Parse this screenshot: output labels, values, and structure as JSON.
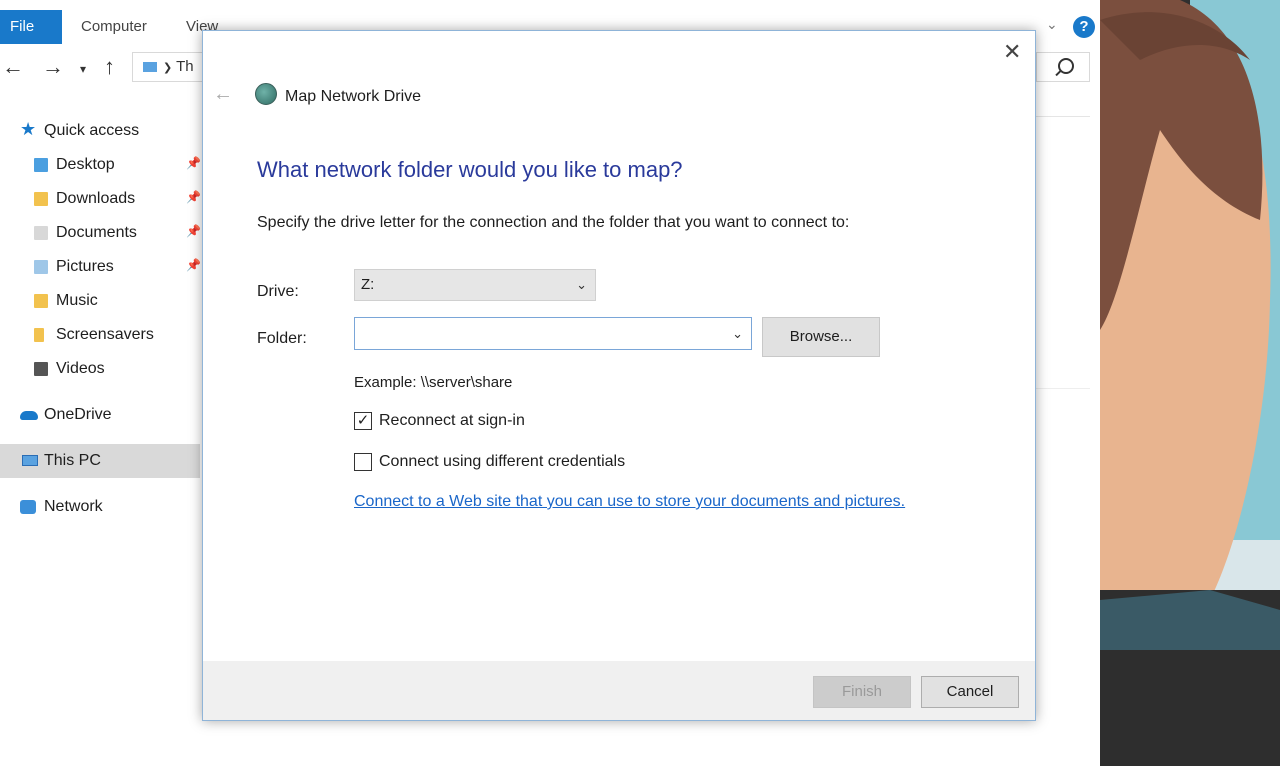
{
  "explorer": {
    "ribbon_tabs": {
      "file": "File",
      "computer": "Computer",
      "view": "View"
    },
    "address_text": "Th",
    "sidebar": {
      "quick_access": "Quick access",
      "desktop": "Desktop",
      "downloads": "Downloads",
      "documents": "Documents",
      "pictures": "Pictures",
      "music": "Music",
      "screensavers": "Screensavers",
      "videos": "Videos",
      "onedrive": "OneDrive",
      "this_pc": "This PC",
      "network": "Network"
    }
  },
  "dialog": {
    "title": "Map Network Drive",
    "heading": "What network folder would you like to map?",
    "instruction": "Specify the drive letter for the connection and the folder that you want to connect to:",
    "drive_label": "Drive:",
    "drive_value": "Z:",
    "folder_label": "Folder:",
    "folder_value": "",
    "browse_label": "Browse...",
    "example": "Example: \\\\server\\share",
    "reconnect_label": "Reconnect at sign-in",
    "reconnect_checked": true,
    "credentials_label": "Connect using different credentials",
    "credentials_checked": false,
    "web_link": "Connect to a Web site that you can use to store your documents and pictures.",
    "finish_label": "Finish",
    "cancel_label": "Cancel"
  },
  "colors": {
    "accent": "#1979ca",
    "heading": "#2a3a9b",
    "link": "#1a66c9"
  }
}
